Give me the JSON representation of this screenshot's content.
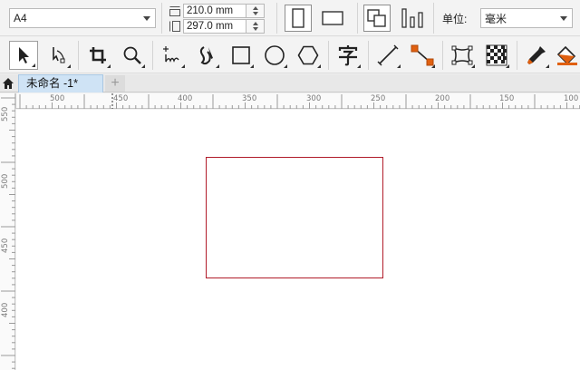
{
  "propbar": {
    "paper_size": "A4",
    "width_value": "210.0 mm",
    "height_value": "297.0 mm",
    "unit_label": "单位:",
    "unit_value": "毫米"
  },
  "tabs": [
    {
      "label": "未命名 -1*",
      "active": true
    }
  ],
  "add_tab_label": "+",
  "ruler": {
    "horizontal": [
      "500",
      "450",
      "400",
      "350",
      "300",
      "250",
      "200",
      "150",
      "100"
    ],
    "vertical": [
      "550",
      "500",
      "450",
      "400"
    ]
  },
  "colors": {
    "shape_outline": "#b11c2a",
    "tab_active": "#cfe3f5",
    "accent_orange": "#e06010"
  },
  "tools": [
    "pick-tool-icon",
    "shape-tool-icon",
    "crop-tool-icon",
    "zoom-tool-icon",
    "freehand-tool-icon",
    "artistic-media-icon",
    "rectangle-tool-icon",
    "ellipse-tool-icon",
    "polygon-tool-icon",
    "text-tool-icon",
    "parallel-dimension-icon",
    "connector-tool-icon",
    "envelope-tool-icon",
    "transparency-tool-icon",
    "eyedropper-tool-icon",
    "fill-tool-icon"
  ]
}
